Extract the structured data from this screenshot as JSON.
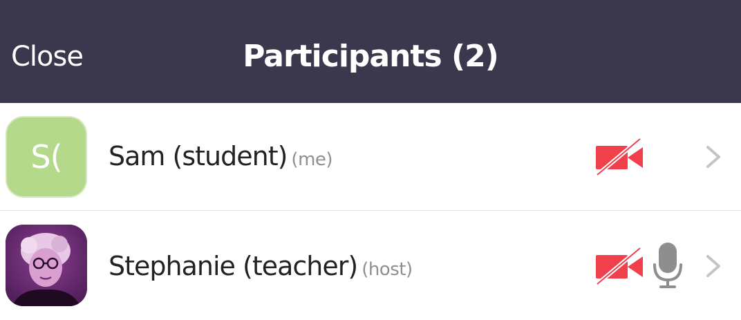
{
  "header": {
    "close_label": "Close",
    "title": "Participants (2)"
  },
  "participants": [
    {
      "initials": "S(",
      "name": "Sam (student)",
      "tag": "(me)",
      "avatar_color": "#b5d98b",
      "video": "off",
      "mic_icon_visible": false
    },
    {
      "name": "Stephanie (teacher)",
      "tag": "(host)",
      "avatar": "photo",
      "video": "off",
      "mic_icon_visible": true
    }
  ],
  "colors": {
    "header_bg": "#3b384d",
    "video_off_red": "#f0404c",
    "mic_gray": "#8e8e8e",
    "chevron_gray": "#c4c4c4"
  },
  "icons": {
    "video_off": "video-off-icon",
    "microphone": "microphone-icon",
    "chevron": "chevron-right-icon"
  }
}
